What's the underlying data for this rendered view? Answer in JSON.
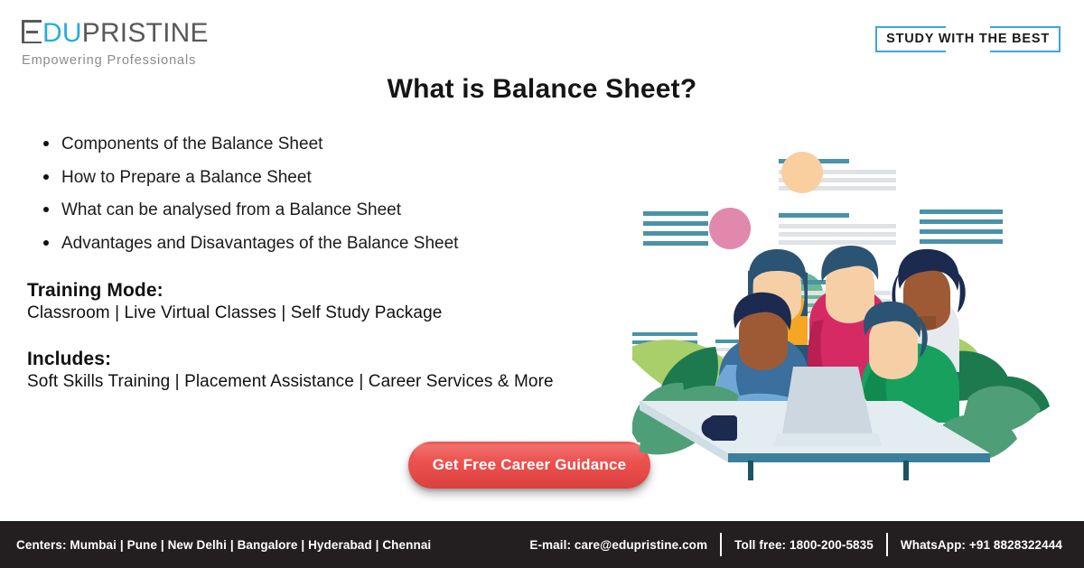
{
  "brand": {
    "logo_edu": "DU",
    "logo_pristine": "PRISTINE",
    "tagline": "Empowering Professionals",
    "logo_accent_color": "#29ABE2",
    "logo_text_color": "#58595b"
  },
  "badge": {
    "label": "STUDY WITH THE BEST",
    "border_color": "#3AA6DE"
  },
  "header": {
    "title": "What is Balance Sheet?"
  },
  "bullets": [
    "Components of the Balance Sheet",
    "How to Prepare a Balance Sheet",
    "What can be analysed from a Balance Sheet",
    "Advantages and Disavantages of the Balance Sheet"
  ],
  "info": {
    "training_mode_heading": "Training Mode:",
    "training_mode_value": "Classroom | Live Virtual Classes | Self Study Package",
    "includes_heading": "Includes:",
    "includes_value": "Soft Skills Training | Placement Assistance | Career Services & More"
  },
  "cta": {
    "label": "Get Free Career Guidance",
    "color": "#ea4f4c"
  },
  "footer": {
    "centers": "Centers: Mumbai | Pune | New Delhi | Bangalore | Hyderabad | Chennai",
    "email": "E-mail: care@edupristine.com",
    "toll_free": "Toll free: 1800-200-5835",
    "whatsapp": "WhatsApp: +91 8828322444",
    "background_color": "#231f20"
  },
  "illustration": {
    "name": "team-around-laptop-with-document-placeholders",
    "accent_line_color": "#4a92a8",
    "muted_line_color": "#dfe3e6",
    "circle_colors": [
      "#f9cfa0",
      "#e089ac",
      "#6bb894"
    ],
    "leaf_colors": [
      "#1d7a4f",
      "#a9cf6b",
      "#4e9e77",
      "#2f8f5f"
    ],
    "table_color": "#e3ecf0",
    "laptop_color": "#ccd7e0"
  }
}
